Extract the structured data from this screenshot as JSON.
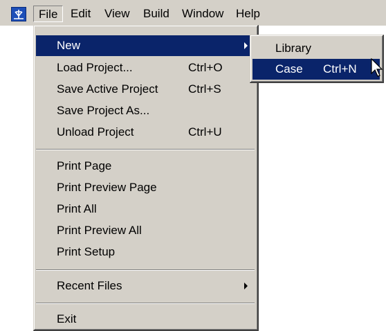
{
  "menubar": {
    "app_icon": "app-logo-icon",
    "items": [
      "File",
      "Edit",
      "View",
      "Build",
      "Window",
      "Help"
    ]
  },
  "file_menu": {
    "new": {
      "label": "New"
    },
    "load_project": {
      "label": "Load Project...",
      "shortcut": "Ctrl+O"
    },
    "save_active_project": {
      "label": "Save Active Project",
      "shortcut": "Ctrl+S"
    },
    "save_project_as": {
      "label": "Save Project As..."
    },
    "unload_project": {
      "label": "Unload Project",
      "shortcut": "Ctrl+U"
    },
    "print_page": {
      "label": "Print Page"
    },
    "print_preview_page": {
      "label": "Print Preview Page"
    },
    "print_all": {
      "label": "Print All"
    },
    "print_preview_all": {
      "label": "Print Preview All"
    },
    "print_setup": {
      "label": "Print Setup"
    },
    "recent_files": {
      "label": "Recent Files"
    },
    "exit": {
      "label": "Exit"
    }
  },
  "new_submenu": {
    "library": {
      "label": "Library"
    },
    "case": {
      "label": "Case",
      "shortcut": "Ctrl+N"
    }
  },
  "colors": {
    "menu_bg": "#d4d0c8",
    "highlight_bg": "#0a246a",
    "highlight_fg": "#ffffff"
  },
  "cursor": "arrow-cursor-icon"
}
